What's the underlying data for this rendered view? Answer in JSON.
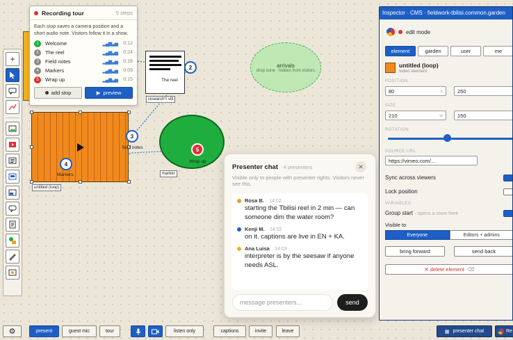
{
  "tour": {
    "title": "Recording tour",
    "count": "5 steps",
    "description": "Each stop saves a camera position and a short audio note. Visitors follow it in a show.",
    "stops": [
      {
        "num": "1",
        "label": "Welcome",
        "time": "0:12",
        "color": "#1fae3e"
      },
      {
        "num": "2",
        "label": "The reel",
        "time": "0:24",
        "color": "#8a8a8a"
      },
      {
        "num": "3",
        "label": "Field notes",
        "time": "0:18",
        "color": "#8a8a8a"
      },
      {
        "num": "4",
        "label": "Markers",
        "time": "0:09",
        "color": "#8a8a8a"
      },
      {
        "num": "5",
        "label": "Wrap up",
        "time": "0:15",
        "color": "#e03030"
      }
    ],
    "add_stop": "add stop",
    "preview": "preview"
  },
  "canvas": {
    "reel_label": "The reel",
    "research_label": "research*/ slit",
    "arrivals_title": "arrivals",
    "arrivals_sub": "drop zone · hidden from visitors",
    "wrap_label": "Wrap up",
    "marker_label": "marker",
    "field_notes_label": "field notes",
    "video_caption": "untitled (loop)",
    "markers_label": "Markers",
    "marker_nums": [
      "2",
      "3",
      "4",
      "5"
    ]
  },
  "chat": {
    "title": "Presenter chat",
    "subtitle": "· 4 presenters",
    "close": "✕",
    "note": "Visible only to people with presenter rights. Visitors never see this.",
    "messages": [
      {
        "who": "Rosa B.",
        "time": "· 14:02",
        "text": "starting the Tbilisi reel in 2 min — can someone dim the water room?",
        "color": "#f0a020"
      },
      {
        "who": "Kenji M.",
        "time": "· 14:02",
        "text": "on it. captions are live in EN + KA.",
        "color": "#1d5fc4"
      },
      {
        "who": "Ana Luisa",
        "time": "· 14:03",
        "text": "interpreter is by the seesaw if anyone needs ASL.",
        "color": "#f0b020"
      }
    ],
    "placeholder": "message presenters...",
    "send": "send"
  },
  "inspector": {
    "title": "Inspector · CMS · fieldwork-tbilisi.common.garden",
    "mode": "edit mode",
    "tabs": [
      "element",
      "garden",
      "user",
      "me"
    ],
    "element_name": "untitled (loop)",
    "element_kind": "video element",
    "position_label": "POSITION",
    "x": "80",
    "x_unit": "x",
    "y": "250",
    "size_label": "SIZE",
    "w": "210",
    "w_unit": "w",
    "h": "150",
    "rotation_label": "ROTATION",
    "rotation_value": 0.5,
    "source_label": "SOURCE URL",
    "source": "https://vimeo.com/...",
    "sync": "Sync across viewers",
    "lock": "Lock position",
    "variables_label": "VARIABLES",
    "group_start": "Group start",
    "group_start_hint": "· opens a room here",
    "visible_to": "Visible to",
    "vis_everyone": "Everyone",
    "vis_editors": "Editors + admins",
    "bring_forward": "bring forward",
    "send_back": "send back",
    "delete": "✕ delete element",
    "delete_key": "⌫"
  },
  "bottombar": {
    "present": "present",
    "guest_mic": "guest mic",
    "tour": "tour",
    "listen_only": "listen only",
    "captions": "captions",
    "invite": "invite",
    "leave": "leave",
    "presenter_chat": "presenter chat",
    "re": "Re"
  }
}
